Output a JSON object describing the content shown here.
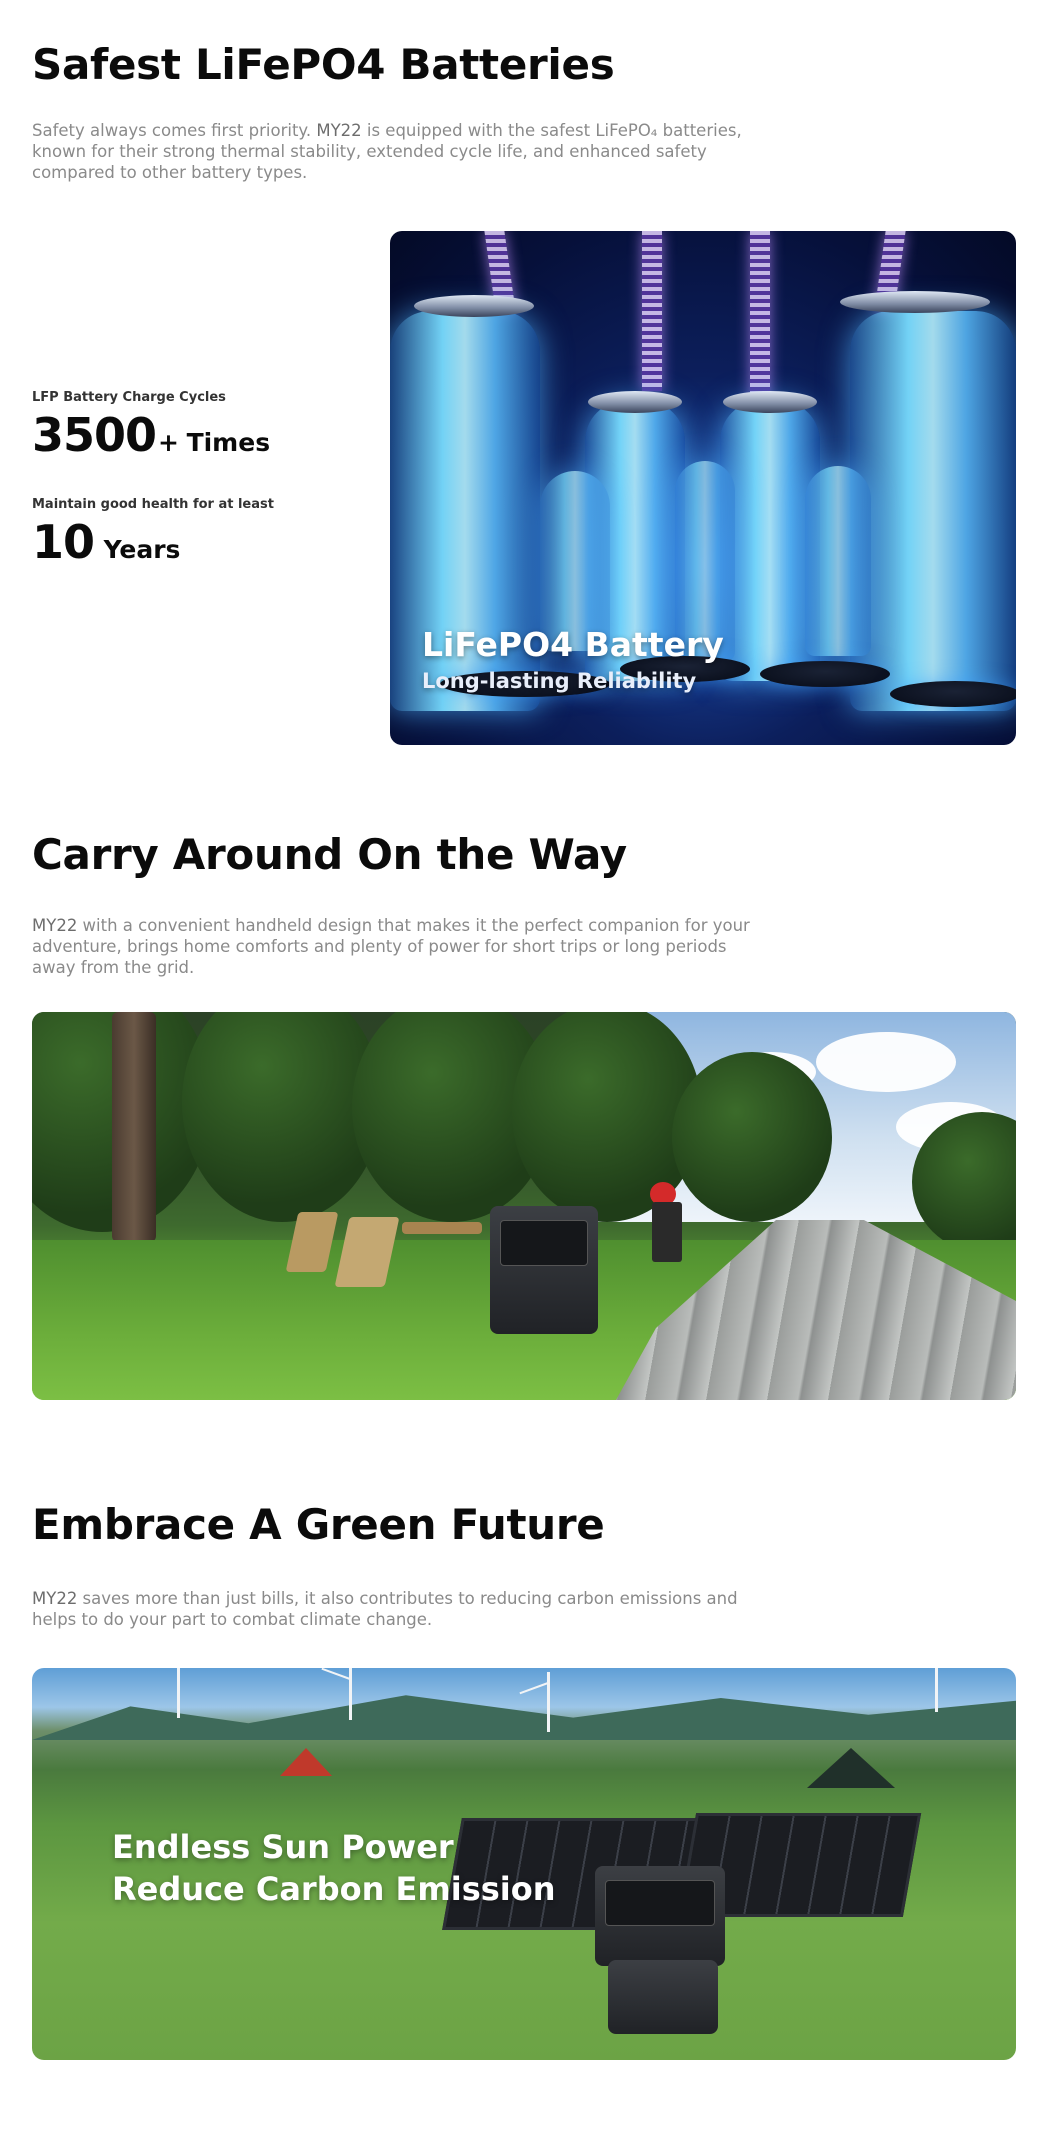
{
  "section_batteries": {
    "title": "Safest LiFePO4 Batteries",
    "description_brand": "MY22",
    "description_before": "Safety always comes first priority. ",
    "description_after": " is equipped with the safest LiFePO₄ batteries, known for their strong thermal stability, extended cycle life, and enhanced safety compared to other battery types.",
    "stats": [
      {
        "label": "LFP Battery Charge Cycles",
        "value": "3500",
        "suffix": "+",
        "unit": "Times"
      },
      {
        "label": "Maintain good health for at least",
        "value": "10",
        "suffix": "",
        "unit": "Years"
      }
    ],
    "image": {
      "caption_title": "LiFePO4 Battery",
      "caption_subtitle": "Long-lasting Reliability"
    }
  },
  "section_carry": {
    "title": "Carry Around On the Way",
    "description_brand": "MY22",
    "description_after": " with a convenient handheld design that makes it the perfect companion for your adventure, brings home comforts and plenty of power for short trips or long periods away from the grid."
  },
  "section_green": {
    "title": "Embrace A Green Future",
    "description_brand": "MY22",
    "description_after": " saves more than just bills, it also contributes to reducing carbon emissions and helps to do your part to combat climate change.",
    "image": {
      "line1": "Endless Sun Power",
      "line2": "Reduce Carbon Emission"
    }
  }
}
